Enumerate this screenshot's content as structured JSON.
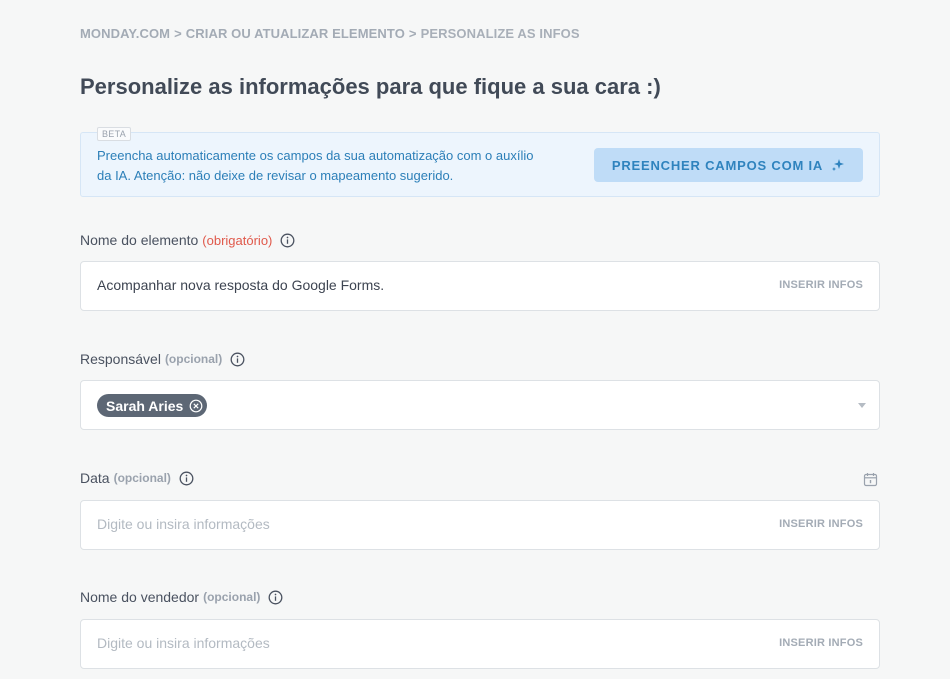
{
  "breadcrumb": {
    "items": [
      "MONDAY.COM",
      "CRIAR OU ATUALIZAR ELEMENTO",
      "PERSONALIZE AS INFOS"
    ],
    "separator": ">"
  },
  "page_title": "Personalize as informações para que fique a sua cara :)",
  "ai_banner": {
    "badge": "BETA",
    "text": "Preencha automaticamente os campos da sua automatização com o auxílio da IA. Atenção: não deixe de revisar o mapeamento sugerido.",
    "button_label": "PREENCHER CAMPOS COM IA",
    "button_icon": "sparkles-icon"
  },
  "fields": {
    "element_name": {
      "label": "Nome do elemento",
      "qualifier": "(obrigatório)",
      "value": "Acompanhar nova resposta do Google Forms.",
      "action": "INSERIR INFOS"
    },
    "responsible": {
      "label": "Responsável",
      "qualifier": "(opcional)",
      "chip": "Sarah Aries"
    },
    "date": {
      "label": "Data",
      "qualifier": "(opcional)",
      "placeholder": "Digite ou insira informações",
      "action": "INSERIR INFOS",
      "icon": "calendar-icon"
    },
    "seller_name": {
      "label": "Nome do vendedor",
      "qualifier": "(opcional)",
      "placeholder": "Digite ou insira informações",
      "action": "INSERIR INFOS"
    }
  },
  "colors": {
    "background": "#f6f7f7",
    "accent": "#2f83be",
    "required": "#e0594b",
    "chip": "#5d6775"
  }
}
